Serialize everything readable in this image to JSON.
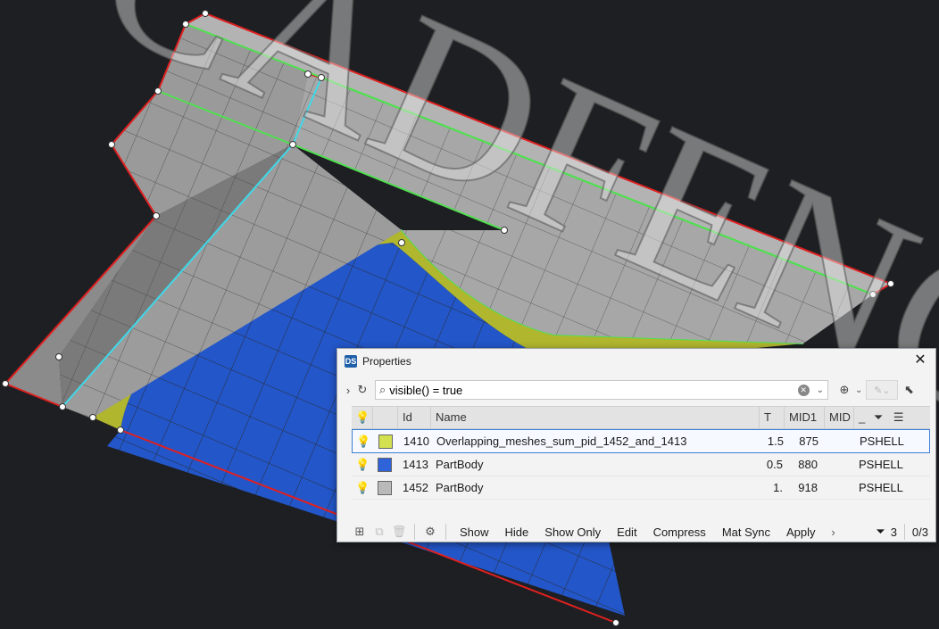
{
  "watermark": "CADFENCE",
  "colors": {
    "background": "#1e1f22",
    "part_1410": "#c9d44a",
    "part_1413": "#2356c8",
    "part_1452": "#b8b8b8",
    "accent": "#3d7fd6"
  },
  "dialog": {
    "title": "Properties",
    "app_icon": "DS",
    "filter": {
      "value": "visible() = true",
      "placeholder": ""
    },
    "columns": [
      "Id",
      "Name",
      "T",
      "MID1",
      "MID",
      "_"
    ],
    "rows": [
      {
        "id": "1410",
        "name": "Overlapping_meshes_sum_pid_1452_and_1413",
        "t": "1.5",
        "mid1": "875",
        "type": "PSHELL",
        "color": "#d3e04f",
        "selected": true
      },
      {
        "id": "1413",
        "name": "PartBody",
        "t": "0.5",
        "mid1": "880",
        "type": "PSHELL",
        "color": "#2f63d9",
        "selected": false
      },
      {
        "id": "1452",
        "name": "PartBody",
        "t": "1.",
        "mid1": "918",
        "type": "PSHELL",
        "color": "#b9b9b9",
        "selected": false
      }
    ],
    "actions": [
      "Show",
      "Hide",
      "Show Only",
      "Edit",
      "Compress",
      "Mat Sync",
      "Apply"
    ],
    "filter_count": "3",
    "selection_count": "0/3"
  },
  "icons": {
    "close": "close-icon",
    "refresh": "refresh-icon",
    "search": "search-icon",
    "bulb": "lightbulb-icon",
    "filter": "funnel-icon",
    "settings": "gear-icon"
  }
}
